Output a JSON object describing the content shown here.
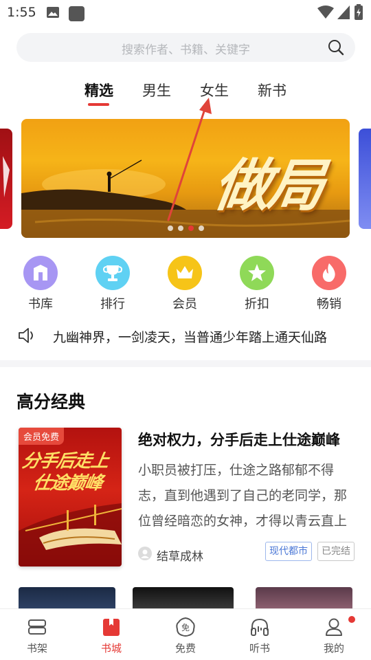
{
  "status_bar": {
    "time": "1:55"
  },
  "search": {
    "placeholder": "搜索作者、书籍、关键字"
  },
  "tabs": [
    {
      "label": "精选",
      "active": true
    },
    {
      "label": "男生",
      "active": false
    },
    {
      "label": "女生",
      "active": false
    },
    {
      "label": "新书",
      "active": false
    }
  ],
  "banner": {
    "title": "做局",
    "slide_count": 4,
    "active_slide": 3
  },
  "categories": [
    {
      "label": "书库",
      "icon": "library-icon",
      "color": "#a796f3"
    },
    {
      "label": "排行",
      "icon": "trophy-icon",
      "color": "#5fd1f3"
    },
    {
      "label": "会员",
      "icon": "crown-icon",
      "color": "#f6c418"
    },
    {
      "label": "折扣",
      "icon": "star-badge-icon",
      "color": "#8fd958"
    },
    {
      "label": "畅销",
      "icon": "flame-icon",
      "color": "#f86b69"
    }
  ],
  "notice": {
    "text": "九幽神界，一剑凌天，当普通少年踏上通天仙路"
  },
  "section": {
    "title": "高分经典",
    "book": {
      "cover_badge": "会员免费",
      "cover_title_line1": "分手后走上",
      "cover_title_line2": "仕途巅峰",
      "title": "绝对权力，分手后走上仕途巅峰",
      "description": "小职员被打压，仕途之路郁郁不得志，直到他遇到了自己的老同学，那位曾经暗恋的女神，才得以青云直上",
      "author": "结草成林",
      "tags": [
        "现代都市",
        "已完结"
      ]
    }
  },
  "bottom_nav": [
    {
      "label": "书架",
      "icon": "bookshelf-icon",
      "active": false
    },
    {
      "label": "书城",
      "icon": "bookstore-icon",
      "active": true
    },
    {
      "label": "免费",
      "icon": "free-icon",
      "active": false
    },
    {
      "label": "听书",
      "icon": "headphones-icon",
      "active": false
    },
    {
      "label": "我的",
      "icon": "profile-icon",
      "active": false,
      "has_badge": true
    }
  ],
  "colors": {
    "accent": "#e53935",
    "tag_blue": "#4a77d6"
  }
}
